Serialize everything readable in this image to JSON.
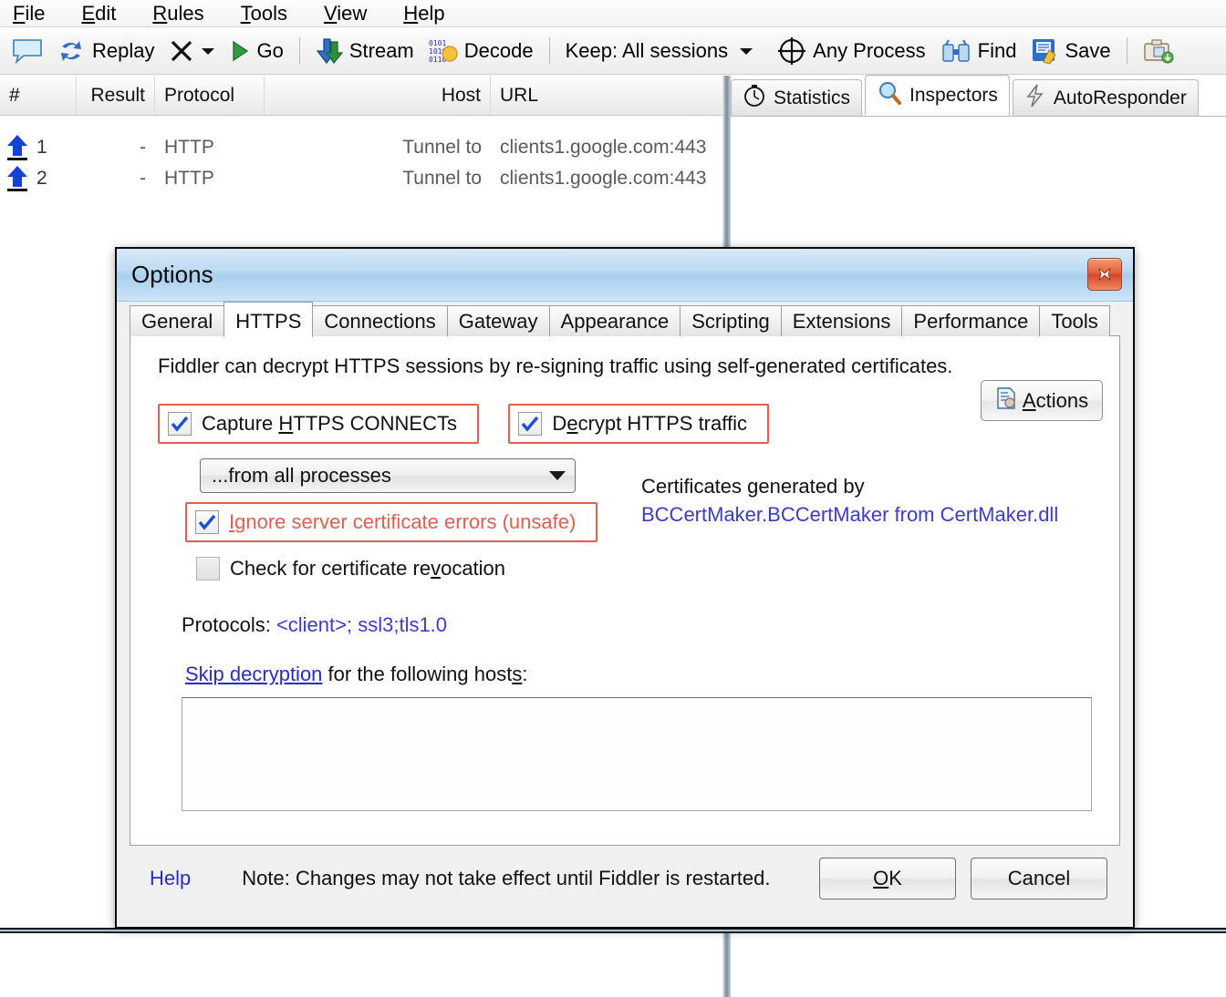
{
  "menubar": {
    "items": [
      {
        "name": "file",
        "pre": "F",
        "rest": "ile"
      },
      {
        "name": "edit",
        "pre": "E",
        "rest": "dit"
      },
      {
        "name": "rules",
        "pre": "R",
        "rest": "ules"
      },
      {
        "name": "tools",
        "pre": "T",
        "rest": "ools"
      },
      {
        "name": "view",
        "pre": "V",
        "rest": "iew"
      },
      {
        "name": "help",
        "pre": "H",
        "rest": "elp"
      }
    ]
  },
  "toolbar": {
    "comment_icon": "speech-bubble-icon",
    "replay_label": "Replay",
    "remove_label": "",
    "go_label": "Go",
    "stream_label": "Stream",
    "decode_label": "Decode",
    "keep_label": "Keep: All sessions",
    "process_label": "Any Process",
    "find_label": "Find",
    "save_label": "Save",
    "capture_icon": "camera-icon"
  },
  "session_grid": {
    "columns": [
      "#",
      "Result",
      "Protocol",
      "Host",
      "URL"
    ],
    "rows": [
      {
        "num": "1",
        "result": "-",
        "protocol": "HTTP",
        "host": "Tunnel to",
        "url": "clients1.google.com:443"
      },
      {
        "num": "2",
        "result": "-",
        "protocol": "HTTP",
        "host": "Tunnel to",
        "url": "clients1.google.com:443"
      }
    ]
  },
  "right_tabs": [
    {
      "label": "Statistics",
      "icon": "stopwatch-icon",
      "active": false
    },
    {
      "label": "Inspectors",
      "icon": "magnifier-icon",
      "active": true
    },
    {
      "label": "AutoResponder",
      "icon": "lightning-icon",
      "active": false
    }
  ],
  "dialog": {
    "title": "Options",
    "close_icon": "close-icon",
    "tabs": [
      {
        "label": "General",
        "active": false
      },
      {
        "label": "HTTPS",
        "active": true
      },
      {
        "label": "Connections",
        "active": false
      },
      {
        "label": "Gateway",
        "active": false
      },
      {
        "label": "Appearance",
        "active": false
      },
      {
        "label": "Scripting",
        "active": false
      },
      {
        "label": "Extensions",
        "active": false
      },
      {
        "label": "Performance",
        "active": false
      },
      {
        "label": "Tools",
        "active": false
      }
    ],
    "intro": "Fiddler can decrypt HTTPS sessions by re-signing traffic using self-generated certificates.",
    "capture_connects": {
      "label_pre": "Capture ",
      "label_accel": "H",
      "label_post": "TTPS CONNECTs",
      "checked": true,
      "highlighted": true
    },
    "decrypt_traffic": {
      "label_pre": "D",
      "label_accel": "e",
      "label_post": "crypt HTTPS traffic",
      "checked": true,
      "highlighted": true
    },
    "process_filter": {
      "value": "...from all processes",
      "caret_icon": "chevron-down-icon"
    },
    "ignore_cert_errors": {
      "label_pre": "I",
      "label_accel": "g",
      "label_post": "nore server certificate errors (unsafe)",
      "checked": true,
      "highlighted": true,
      "color": "#e2604f"
    },
    "check_revocation": {
      "label_pre": "Check for certificate re",
      "label_accel": "v",
      "label_post": "ocation",
      "checked": false
    },
    "actions_button": {
      "label_pre": "A",
      "label_post": "ctions",
      "icon": "certificate-actions-icon"
    },
    "certificates": {
      "line1": "Certificates generated by",
      "line2": "BCCertMaker.BCCertMaker from CertMaker.dll",
      "link_color": "#3b3bd0"
    },
    "protocols": {
      "label": "Protocols: ",
      "value": "<client>; ssl3;tls1.0"
    },
    "skip_decryption": {
      "link": "Skip decryption",
      "rest_pre": " for the following host",
      "accel": "s",
      "rest_post": ":"
    },
    "host_list_value": "",
    "footer": {
      "help_label": "Help",
      "note": "Note: Changes may not take effect until Fiddler is restarted.",
      "ok_pre": "O",
      "ok_post": "K",
      "cancel_label": "Cancel"
    }
  },
  "colors": {
    "highlight_red": "#e2604f",
    "link_blue": "#2b2bc8",
    "title_blue": "#a9cfee"
  }
}
